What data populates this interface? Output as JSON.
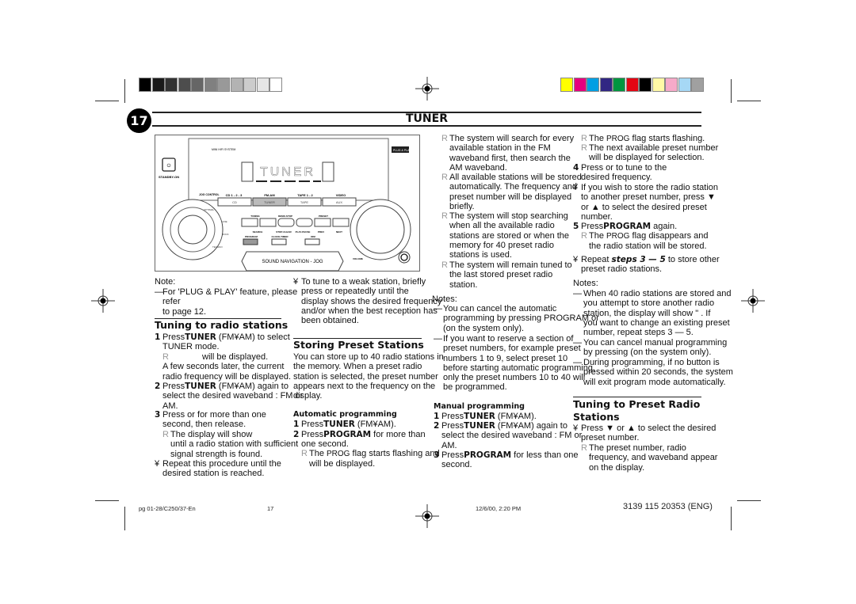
{
  "header": {
    "page_number": "17",
    "title": "TUNER"
  },
  "swatches": {
    "grays": [
      "#000000",
      "#1a1a1a",
      "#333333",
      "#4d4d4d",
      "#666666",
      "#808080",
      "#999999",
      "#b3b3b3",
      "#cccccc",
      "#e6e6e6",
      "#ffffff"
    ],
    "colors": [
      "#ffff00",
      "#e6007e",
      "#009fe3",
      "#312783",
      "#009640",
      "#e30613",
      "#000000",
      "#fff9a6",
      "#f6aac9",
      "#a6d8f5",
      "#a0a0a0"
    ]
  },
  "device": {
    "brand_small": "MINI HIFI SYSTEM",
    "display_text": "TUNER",
    "plug_play": "PLUG & PLAY",
    "standby": "STANDBY-ON",
    "jog_control": "JOG CONTROL",
    "source_labels": [
      "CD 1 - 2 - 3",
      "FM-AM",
      "TAPE 1 - 2",
      "VIDEO"
    ],
    "source_buttons": [
      "CD",
      "TUNER",
      "TAPE",
      "AUX"
    ],
    "top_labels": [
      "TUNING",
      "DEMO-STOP",
      "PRESET"
    ],
    "bottom_labels": [
      "SEARCH",
      "STOP-CLEAR",
      "PLAY-PAUSE",
      "PREV",
      "NEXT"
    ],
    "small_buttons": [
      "PROGRAM",
      "CLOCK-TIMER",
      "DIM"
    ],
    "side_labels": [
      "OPTIMAL",
      "LINE",
      "ROCK",
      "TECHNO"
    ],
    "sound_nav": "SOUND NAVIGATION - JOG",
    "volume": "VOLUME"
  },
  "col1": {
    "note_label": "Note:",
    "note_dash": "—",
    "note_text": "For 'PLUG & PLAY' feature, please refer\nto page 12.",
    "heading": "Tuning to radio stations",
    "s1_num": "1",
    "s1_a": "Press",
    "s1_b": "TUNER",
    "s1_c": " (FM¥AM) to select\nTUNER mode.",
    "s1_r": "R",
    "s1_r_text": "will be displayed.\nA few seconds later, the current\nradio frequency will be displayed.",
    "s2_num": "2",
    "s2_a": "Press",
    "s2_b": "TUNER",
    "s2_c": " (FM¥AM) again to\nselect the desired waveband : FM or\nAM.",
    "s3_num": "3",
    "s3_text": "Press    or      for more than one\nsecond, then release.",
    "s3_r": "R",
    "s3_r_text": "The display will show\nuntil a radio station with sufficient\nsignal strength is found.",
    "rep_mark": "¥",
    "rep_text": "Repeat this procedure until the\ndesired station is reached."
  },
  "col2": {
    "weak_mark": "¥",
    "weak_text": "To tune to a weak station, briefly\npress     or      repeatedly until the\ndisplay shows the desired frequency\nand/or when the best reception has\nbeen obtained.",
    "heading": "Storing Preset Stations",
    "intro": "You can store up to 40 radio stations in\nthe memory. When a preset radio\nstation is selected, the preset number\nappears next to the frequency on the\ndisplay.",
    "auto_heading": "Automatic programming",
    "a1_num": "1",
    "a1_a": "Press",
    "a1_b": "TUNER",
    "a1_c": " (FM¥AM).",
    "a2_num": "2",
    "a2_a": "Press",
    "a2_b": "PROGRAM",
    "a2_c": " for more than\none second.",
    "a2_r": "R",
    "a2_r_a": "The ",
    "a2_r_b": "PROG",
    "a2_r_c": " flag starts flashing and\n               will be displayed."
  },
  "col3": {
    "r_mark": "R",
    "r1": "The system will search for every\navailable station in the FM\nwaveband first, then search the\nAM waveband.",
    "r2": "All available stations will be stored\nautomatically. The frequency and\npreset number will be displayed\nbriefly.",
    "r3": "The system  will stop searching\nwhen all the available radio\nstations are stored or when the\nmemory for 40 preset radio\nstations is used.",
    "r4": "The system will remain tuned to\nthe last stored preset radio\nstation.",
    "notes_label": "Notes:",
    "dash": "—",
    "n1": "You can cancel the automatic\nprogramming by pressing PROGRAM or\n    (on the system only).",
    "n2": "If you want to reserve a section of\npreset numbers, for example preset\nnumbers 1 to 9, select preset 10\nbefore starting automatic programming,\nonly the preset numbers 10 to 40 will\nbe programmed.",
    "manual_heading": "Manual programming",
    "m1_num": "1",
    "m1_a": "Press",
    "m1_b": "TUNER",
    "m1_c": " (FM¥AM).",
    "m2_num": "2",
    "m2_a": "Press",
    "m2_b": "TUNER",
    "m2_c": " (FM¥AM) again to\nselect the desired waveband : FM or\nAM.",
    "m3_num": "3",
    "m3_a": "Press",
    "m3_b": "PROGRAM",
    "m3_c": " for less than one\nsecond."
  },
  "col4": {
    "r_mark": "R",
    "r1_a": "The ",
    "r1_b": "PROG",
    "r1_c": " flag starts flashing.",
    "r2": "The next available preset number\nwill be displayed for selection.",
    "s4_num": "4",
    "s4_text": "Press    or      to tune to the\ndesired frequency.",
    "y_mark": "¥",
    "y1": "If you wish to store the radio station\nto another preset number, press ▼\nor ▲ to select the desired preset\nnumber.",
    "s5_num": "5",
    "s5_a": "Press",
    "s5_b": "PROGRAM",
    "s5_c": " again.",
    "r3_a": "The ",
    "r3_b": "PROG",
    "r3_c": " flag disappears and\nthe radio station will be stored.",
    "y2_a": "Repeat ",
    "y2_b": "steps 3 — 5",
    "y2_c": " to store other\npreset radio stations.",
    "notes_label": "Notes:",
    "dash": "—",
    "n1": "When 40 radio stations are stored and\nyou attempt to store another radio\nstation, the display will show \" . If\nyou want to change an existing preset\nnumber, repeat steps 3 — 5.",
    "n2": "You can cancel manual programming\nby pressing   (on the system only).",
    "n3": "During programming,  if no button is\npressed within 20 seconds, the system\nwill exit program mode automatically.",
    "heading": "Tuning to Preset Radio\nStations",
    "p_text": "Press ▼ or ▲ to select the desired\npreset number.",
    "p_r": "The preset number, radio\nfrequency, and waveband appear\non the display."
  },
  "footer": {
    "file": "pg 01-28/C250/37-En",
    "page": "17",
    "date": "12/6/00, 2:20 PM",
    "code": "3139 115 20353 (ENG)"
  }
}
